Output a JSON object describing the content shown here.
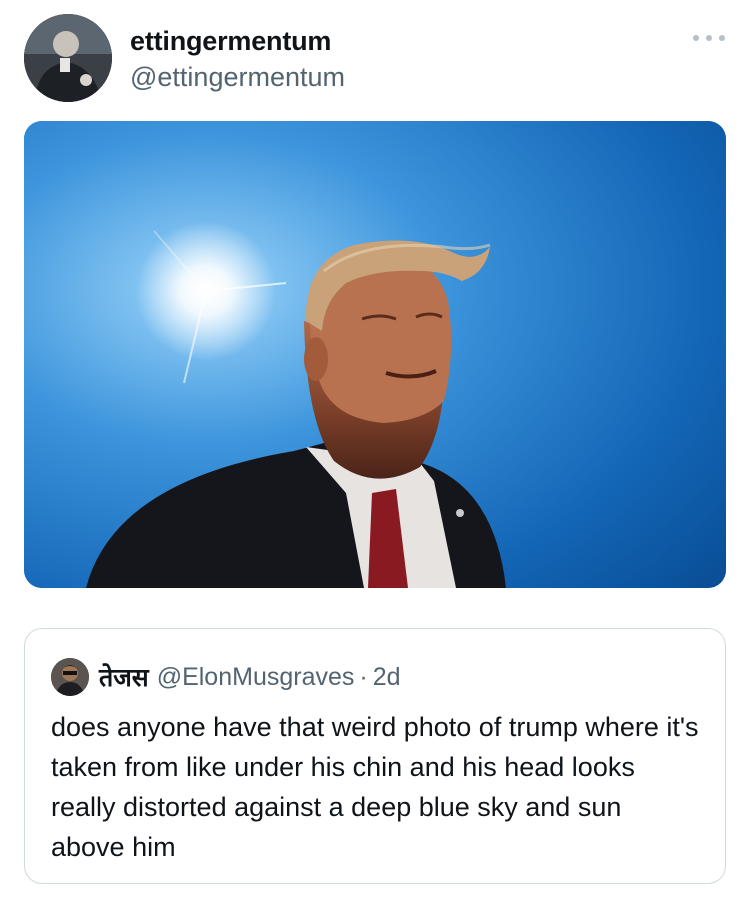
{
  "author": {
    "display_name": "ettingermentum",
    "handle": "@ettingermentum",
    "avatar_icon": "profile-avatar"
  },
  "menu": {
    "icon": "more-horizontal-icon"
  },
  "media": {
    "icon": "photo-sky-sun-portrait",
    "colors": {
      "sky_light": "#6fb8ee",
      "sky_dark": "#0d5aa8",
      "suit": "#15161c",
      "tie": "#8a1a22"
    }
  },
  "quoted_tweet": {
    "display_name": "तेजस",
    "handle": "@ElonMusgraves",
    "separator": "·",
    "time": "2d",
    "text": "does anyone have that weird photo of trump where it's taken from like under his chin and his head looks really distorted against a deep blue sky and sun above him",
    "avatar_icon": "profile-avatar"
  }
}
